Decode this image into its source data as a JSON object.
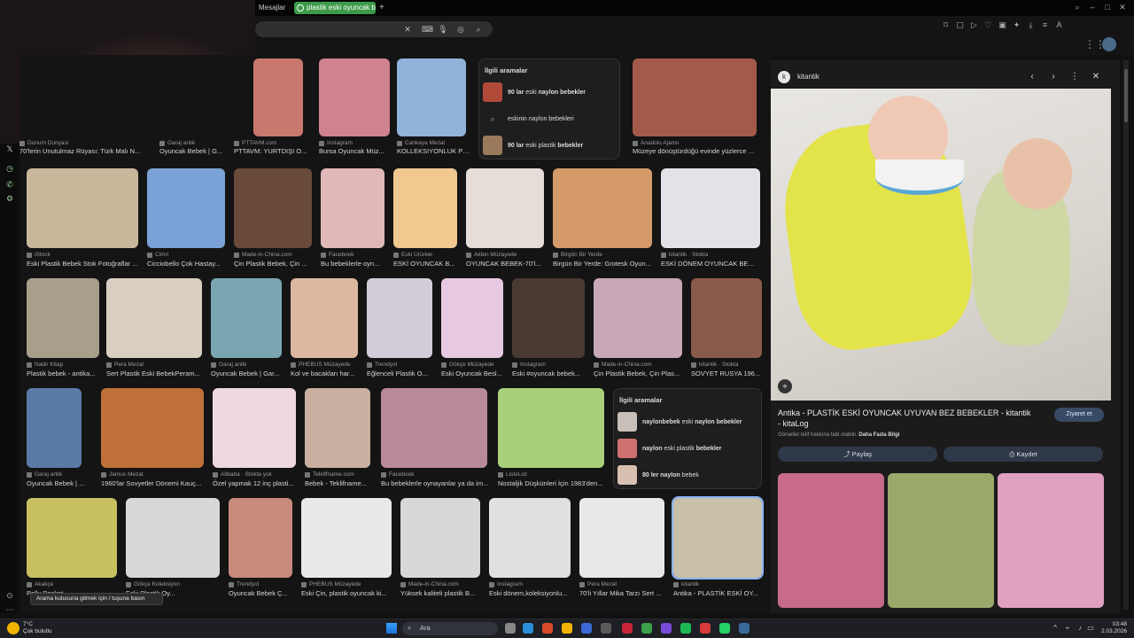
{
  "browser": {
    "tabs": [
      {
        "label": "Mesajlar"
      },
      {
        "label": "plastik eski oyuncak bebek"
      }
    ],
    "new_tab_symbol": "+"
  },
  "search": {
    "value": ""
  },
  "results": {
    "row1": [
      {
        "source": "Dunum Dunyasi",
        "title": "70'lerin Unutulmaz Rüyası: Türk Malı N...",
        "color": "#b98a8a"
      },
      {
        "source": "Garaj antik",
        "title": "Oyuncak Bebek | G...",
        "color": "#d8a7a0"
      },
      {
        "source": "PTTAVM.com",
        "title": "PTTAVM: YURTDIŞI O...",
        "color": "#c9786e"
      },
      {
        "source": "Instagram",
        "title": "Bursa Oyuncak Müz...",
        "color": "#d0828f"
      },
      {
        "source": "Cankaya Mezat",
        "title": "KOLLEKSIYONLUK PL...",
        "color": "#8fb3d9"
      },
      {
        "source": "Anadolu Ajansı",
        "title": "Müzeye dönüştürdüğü evinde yüzlerce eski...",
        "color": "#a45a4a"
      }
    ],
    "related1": {
      "heading": "İlgili aramalar",
      "items": [
        {
          "bold1": "90 lar",
          "text": " eski ",
          "bold2": "naylon bebekler",
          "color": "#b24a3a"
        },
        {
          "bold1": "",
          "text": "eskinin naylon bebekleri",
          "bold2": "",
          "color": ""
        },
        {
          "bold1": "90 lar",
          "text": " eski plastik ",
          "bold2": "bebekler",
          "color": "#9a7a5a"
        }
      ]
    },
    "row2": [
      {
        "source": "iStock",
        "title": "Eski Plastik Bebek Stok Fotoğraflar ...",
        "color": "#c9b79c"
      },
      {
        "source": "Cimri",
        "title": "Cicciobello Çok Hastay...",
        "color": "#7aa2d6"
      },
      {
        "source": "Made-in-China.com",
        "title": "Çin Plastik Bebek, Çin ...",
        "color": "#6a4a3a"
      },
      {
        "source": "Facebook",
        "title": "Bu bebeklerle oyn...",
        "color": "#e0b8b8"
      },
      {
        "source": "Eski Ürünler",
        "title": "ESKİ OYUNCAK B...",
        "color": "#f0c890"
      },
      {
        "source": "Akten Müzayede",
        "title": "OYUNCAK BEBEK-70'l...",
        "color": "#e6dcd8"
      },
      {
        "source": "Birgün Bir Yerde",
        "title": "Birgün Bir Yerde: Grotesk Oyun...",
        "color": "#d49a6a"
      },
      {
        "source": "kitantik · Stokta",
        "title": "ESKİ DÖNEM OYUNCAK BEB...",
        "color": "#e2e2e8"
      }
    ],
    "row3": [
      {
        "source": "Nadir Kitap",
        "title": "Plastik bebek - antika...",
        "color": "#a89e8a"
      },
      {
        "source": "Pera Mezat",
        "title": "Sert Plastik Eski BebekPeram...",
        "color": "#d8cfc2"
      },
      {
        "source": "Garaj antik",
        "title": "Oyuncak Bebek | Gar...",
        "color": "#7aa6b2"
      },
      {
        "source": "PHEBUS Müzayede",
        "title": "Kol ve bacakları har...",
        "color": "#dcb8a0"
      },
      {
        "source": "Trendyol",
        "title": "Eğlenceli Plastik O...",
        "color": "#d4cbd9"
      },
      {
        "source": "Gökçe Müzayede",
        "title": "Eski Oyuncak Besl...",
        "color": "#e6c8e0"
      },
      {
        "source": "Instagram",
        "title": "Eski #oyuncak bebek...",
        "color": "#4a3a34"
      },
      {
        "source": "Made-in-China.com",
        "title": "Çin Plastik Bebek, Çin Plas...",
        "color": "#c8a8b8"
      },
      {
        "source": "kitantik · Stokta",
        "title": "SOVYET RUSYA 196...",
        "color": "#8a5a4a"
      }
    ],
    "row4": [
      {
        "source": "Garaj antik",
        "title": "Oyuncak Bebek | ...",
        "color": "#5a7aa8"
      },
      {
        "source": "Jamus Mezat",
        "title": "1960'lar Sovyetler Dönemi Kauç...",
        "color": "#c0703a"
      },
      {
        "source": "Alibaba · Stokta yok",
        "title": "Özel yapmak 12 inç plasti...",
        "color": "#f0d8e0"
      },
      {
        "source": "Tekliffname.com",
        "title": "Bebek - Teklifname...",
        "color": "#c9b0a0"
      },
      {
        "source": "Facebook",
        "title": "Bu bebeklerle oynayanlar ya da im...",
        "color": "#b88a9a"
      },
      {
        "source": "ListeList",
        "title": "Nostaljik Düşkünleri İçin 1983'den...",
        "color": "#a8d07a"
      }
    ],
    "related2": {
      "heading": "İlgili aramalar",
      "items": [
        {
          "bold1": "naylonbebek",
          "text": " eski ",
          "bold2": "naylon bebekler",
          "color": "#c8c0b8"
        },
        {
          "bold1": "naylon",
          "text": " eski plastik ",
          "bold2": "bebekler",
          "color": "#d07070"
        },
        {
          "bold1": "80 ler",
          "text": " ",
          "bold2": "naylon",
          "text2": " bebek",
          "color": "#d8c0b0"
        }
      ]
    },
    "row5": [
      {
        "source": "Akakçe",
        "title": "Polly Pocket...",
        "color": "#c8c060"
      },
      {
        "source": "Gökçe Koleksiyon",
        "title": "Eski Plastik Oy...",
        "color": "#d8d8d8"
      },
      {
        "source": "Trendyol",
        "title": "Oyuncak Bebek Ç...",
        "color": "#c88a7a"
      },
      {
        "source": "PHEBUS Müzayede",
        "title": "Eski Çin, plastik oyuncak ki...",
        "color": "#e8e8e8"
      },
      {
        "source": "Made-in-China.com",
        "title": "Yüksek kaliteli plastik B...",
        "color": "#d8d8d8"
      },
      {
        "source": "Instagram",
        "title": "Eski dönem,koleksiyonlu...",
        "color": "#e0e0e0"
      },
      {
        "source": "Pera Mezat",
        "title": "70'li Yıllar Mika Tarzı Sert ...",
        "color": "#e8e8e8"
      },
      {
        "source": "kitantik",
        "title": "Antika - PLASTİK ESKİ OY...",
        "color": "#c8c0a8"
      }
    ]
  },
  "preview": {
    "site": "kitantik",
    "title": "Antika - PLASTİK ESKİ OYUNCAK UYUYAN BEZ BEBEKLER - kitantik - kitaLog",
    "license_prefix": "Görseller telif hakkına tabi olabilir.",
    "license_link": "Daha Fazla Bilgi",
    "visit": "Ziyaret et",
    "share": "Paylaş",
    "save": "Kaydet"
  },
  "tooltip": "Arama kutusuna gitmek için / tuşuna basın",
  "taskbar": {
    "temp": "7°C",
    "weather": "Çok bulutlu",
    "search": "Ara",
    "time": "03:48",
    "date": "2.03.2026"
  }
}
